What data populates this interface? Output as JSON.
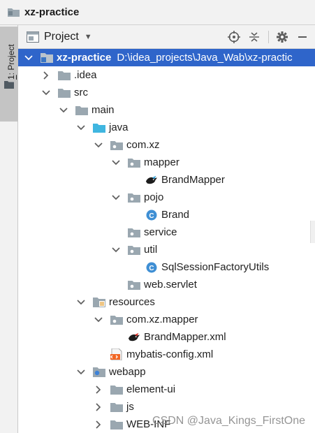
{
  "window": {
    "title": "xz-practice"
  },
  "strip": {
    "tab_number": "1",
    "tab_label": ": Project"
  },
  "toolwindow": {
    "title": "Project"
  },
  "tree": [
    {
      "label": "xz-practice",
      "path": "D:\\idea_projects\\Java_Wab\\xz-practic",
      "depth": 0,
      "arrow": "down",
      "icon": "module-folder",
      "selected": true
    },
    {
      "label": ".idea",
      "depth": 1,
      "arrow": "right",
      "icon": "folder"
    },
    {
      "label": "src",
      "depth": 1,
      "arrow": "down",
      "icon": "folder"
    },
    {
      "label": "main",
      "depth": 2,
      "arrow": "down",
      "icon": "folder"
    },
    {
      "label": "java",
      "depth": 3,
      "arrow": "down",
      "icon": "source-folder"
    },
    {
      "label": "com.xz",
      "depth": 4,
      "arrow": "down",
      "icon": "package"
    },
    {
      "label": "mapper",
      "depth": 5,
      "arrow": "down",
      "icon": "package"
    },
    {
      "label": "BrandMapper",
      "depth": 6,
      "arrow": "none",
      "icon": "mybatis-interface"
    },
    {
      "label": "pojo",
      "depth": 5,
      "arrow": "down",
      "icon": "package"
    },
    {
      "label": "Brand",
      "depth": 6,
      "arrow": "none",
      "icon": "class"
    },
    {
      "label": "service",
      "depth": 5,
      "arrow": "none",
      "icon": "package"
    },
    {
      "label": "util",
      "depth": 5,
      "arrow": "down",
      "icon": "package"
    },
    {
      "label": "SqlSessionFactoryUtils",
      "depth": 6,
      "arrow": "none",
      "icon": "class"
    },
    {
      "label": "web.servlet",
      "depth": 5,
      "arrow": "none",
      "icon": "package"
    },
    {
      "label": "resources",
      "depth": 3,
      "arrow": "down",
      "icon": "resources-folder"
    },
    {
      "label": "com.xz.mapper",
      "depth": 4,
      "arrow": "down",
      "icon": "package"
    },
    {
      "label": "BrandMapper.xml",
      "depth": 5,
      "arrow": "none",
      "icon": "mybatis-xml"
    },
    {
      "label": "mybatis-config.xml",
      "depth": 4,
      "arrow": "none",
      "icon": "xml-file"
    },
    {
      "label": "webapp",
      "depth": 3,
      "arrow": "down",
      "icon": "web-folder"
    },
    {
      "label": "element-ui",
      "depth": 4,
      "arrow": "right",
      "icon": "folder"
    },
    {
      "label": "js",
      "depth": 4,
      "arrow": "right",
      "icon": "folder"
    },
    {
      "label": "WEB-INF",
      "depth": 4,
      "arrow": "right",
      "icon": "folder"
    }
  ],
  "watermark": "CSDN @Java_Kings_FirstOne",
  "colors": {
    "selection": "#2f65ca",
    "folder": "#9aa7b0",
    "source_folder": "#40b6e0",
    "class_icon": "#3f8fd4"
  }
}
